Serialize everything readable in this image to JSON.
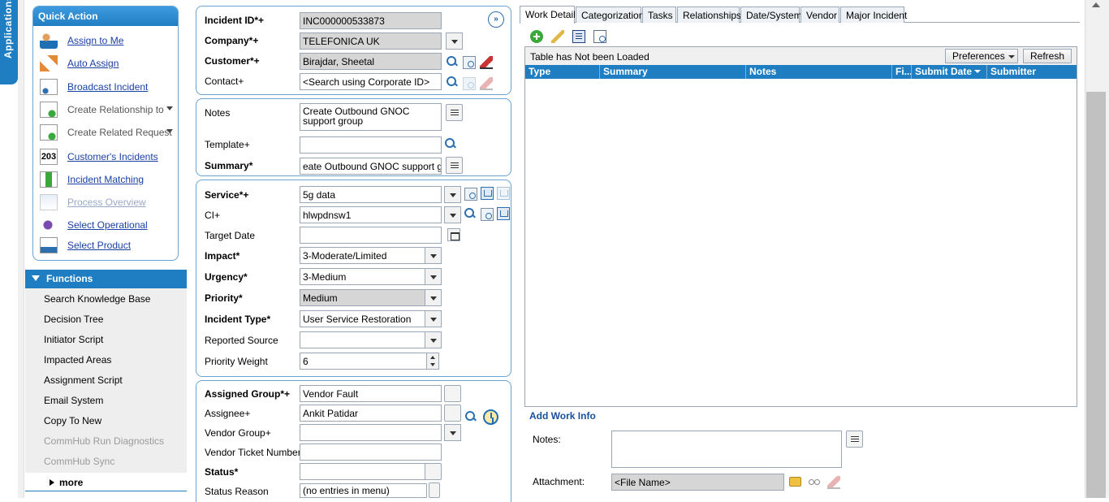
{
  "apps_tab": {
    "label": "Applications"
  },
  "quick_action": {
    "title": "Quick Action",
    "items": [
      {
        "label": "Assign to Me",
        "icon": "person-assign-icon"
      },
      {
        "label": "Auto Assign",
        "icon": "auto-assign-icon"
      },
      {
        "label": "Broadcast Incident",
        "icon": "broadcast-icon"
      },
      {
        "label": "Create Relationship to",
        "icon": "relationship-icon"
      },
      {
        "label": "Create Related Request",
        "icon": "related-request-icon"
      },
      {
        "label": "Customer's Incidents",
        "icon": "customer-incidents-icon",
        "count": "203"
      },
      {
        "label": "Incident Matching",
        "icon": "incident-matching-icon"
      },
      {
        "label": "Process Overview",
        "icon": "process-overview-icon"
      },
      {
        "label": "Select Operational",
        "icon": "select-operational-icon"
      },
      {
        "label": "Select Product",
        "icon": "select-product-icon"
      }
    ]
  },
  "functions": {
    "title": "Functions",
    "items": [
      "Search Knowledge Base",
      "Decision Tree",
      "Initiator Script",
      "Impacted Areas",
      "Assignment Script",
      "Email System",
      "Copy To New",
      "CommHub Run Diagnostics",
      "CommHub Sync"
    ],
    "more": "more"
  },
  "form": {
    "incident_id": {
      "label": "Incident ID*+",
      "value": "INC000000533873"
    },
    "company": {
      "label": "Company*+",
      "value": "TELEFONICA UK"
    },
    "customer": {
      "label": "Customer*+",
      "value": "Birajdar, Sheetal"
    },
    "contact": {
      "label": "Contact+",
      "value": "<Search using Corporate ID>"
    },
    "notes": {
      "label": "Notes",
      "value": "Create Outbound GNOC support group"
    },
    "template": {
      "label": "Template+",
      "value": ""
    },
    "summary": {
      "label": "Summary*",
      "value": "eate Outbound GNOC support group"
    },
    "service": {
      "label": "Service*+",
      "value": "5g data"
    },
    "ci": {
      "label": "CI+",
      "value": "hlwpdnsw1"
    },
    "target_date": {
      "label": "Target Date",
      "value": ""
    },
    "impact": {
      "label": "Impact*",
      "value": "3-Moderate/Limited"
    },
    "urgency": {
      "label": "Urgency*",
      "value": "3-Medium"
    },
    "priority": {
      "label": "Priority*",
      "value": "Medium"
    },
    "incident_type": {
      "label": "Incident Type*",
      "value": "User Service Restoration"
    },
    "reported_source": {
      "label": "Reported Source",
      "value": ""
    },
    "priority_weight": {
      "label": "Priority Weight",
      "value": "6"
    },
    "assigned_group": {
      "label": "Assigned Group*+",
      "value": "Vendor Fault"
    },
    "assignee": {
      "label": "Assignee+",
      "value": "Ankit Patidar"
    },
    "vendor_group": {
      "label": "Vendor Group+",
      "value": ""
    },
    "vendor_ticket": {
      "label": "Vendor Ticket Number",
      "value": ""
    },
    "status": {
      "label": "Status*",
      "value": ""
    },
    "status_reason": {
      "label": "Status Reason",
      "value": "(no entries in menu)"
    },
    "expand_button": "»"
  },
  "tabs": [
    "Work Detail",
    "Categorization",
    "Tasks",
    "Relationships",
    "Date/System",
    "Vendor",
    "Major Incident"
  ],
  "work_detail": {
    "table_status": "Table has Not been Loaded",
    "preferences": "Preferences",
    "refresh": "Refresh",
    "columns": [
      "Type",
      "Summary",
      "Notes",
      "Fi...",
      "Submit Date",
      "Submitter"
    ],
    "add_work_info": "Add Work Info",
    "notes_label": "Notes:",
    "attachment_label": "Attachment:",
    "file_placeholder": "<File Name>"
  }
}
